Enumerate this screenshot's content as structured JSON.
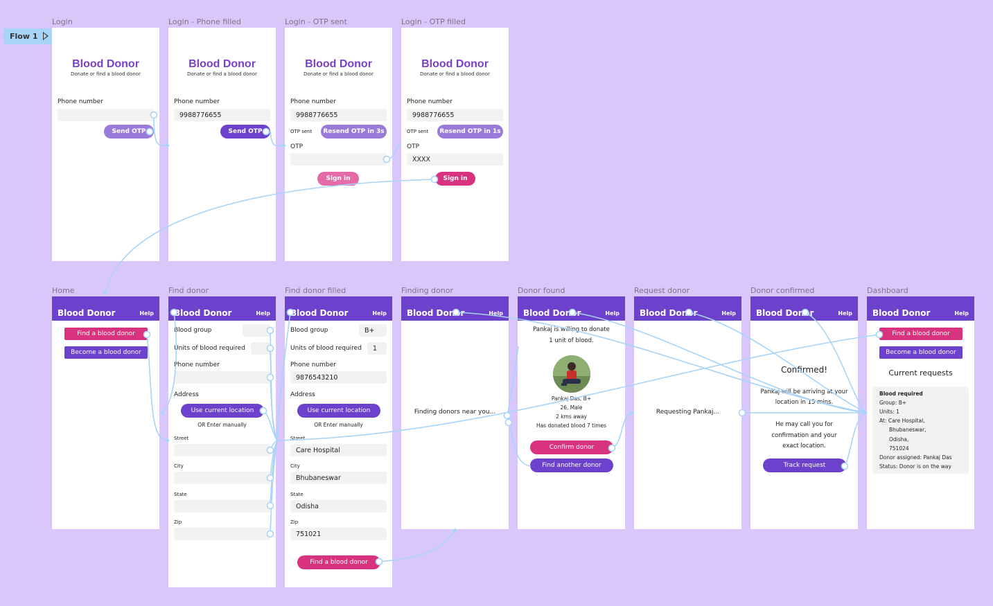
{
  "flow": {
    "label": "Flow 1",
    "play_icon": "play-icon"
  },
  "brand": {
    "name": "Blood Donor",
    "tagline": "Donate or find a blood donor",
    "primary": "#6c41cc",
    "accent": "#d9337f",
    "light_accent": "#e56aa8",
    "wire": "#a8d4f7",
    "canvas": "#d9c7fa"
  },
  "screens": {
    "login": {
      "label": "Login",
      "phone_label": "Phone number",
      "phone_value": "",
      "send_label": "Send OTP"
    },
    "login_phone": {
      "label": "Login - Phone filled",
      "phone_label": "Phone number",
      "phone_value": "9988776655",
      "send_label": "Send OTP"
    },
    "login_otp_sent": {
      "label": "Login - OTP sent",
      "phone_label": "Phone number",
      "phone_value": "9988776655",
      "otp_sent_label": "OTP sent",
      "resend_label": "Resend OTP in 3s",
      "otp_label": "OTP",
      "otp_value": "",
      "signin_label": "Sign in"
    },
    "login_otp_filled": {
      "label": "Login - OTP filled",
      "phone_label": "Phone number",
      "phone_value": "9988776655",
      "otp_sent_label": "OTP sent",
      "resend_label": "Resend OTP in 1s",
      "otp_label": "OTP",
      "otp_value": "XXXX",
      "signin_label": "Sign in"
    },
    "home": {
      "label": "Home",
      "header_title": "Blood Donor",
      "help": "Help",
      "find_label": "Find a blood donor",
      "become_label": "Become a blood donor"
    },
    "find_donor": {
      "label": "Find donor",
      "header_title": "Blood Donor",
      "help": "Help",
      "blood_group_label": "Blood group",
      "blood_group_value": "",
      "units_label": "Units of blood required",
      "units_value": "",
      "phone_label": "Phone number",
      "phone_value": "",
      "address_label": "Address",
      "use_location_label": "Use current location",
      "or_manual": "OR Enter manually",
      "street_label": "Street",
      "street_value": "",
      "city_label": "City",
      "city_value": "",
      "state_label": "State",
      "state_value": "",
      "zip_label": "Zip",
      "zip_value": ""
    },
    "find_donor_filled": {
      "label": "Find donor filled",
      "header_title": "Blood Donor",
      "help": "Help",
      "blood_group_label": "Blood group",
      "blood_group_value": "B+",
      "units_label": "Units of blood required",
      "units_value": "1",
      "phone_label": "Phone number",
      "phone_value": "9876543210",
      "address_label": "Address",
      "use_location_label": "Use current location",
      "or_manual": "OR Enter manually",
      "street_label": "Street",
      "street_value": "Care Hospital",
      "city_label": "City",
      "city_value": "Bhubaneswar",
      "state_label": "State",
      "state_value": "Odisha",
      "zip_label": "Zip",
      "zip_value": "751021",
      "find_label": "Find a blood donor"
    },
    "finding_donor": {
      "label": "Finding donor",
      "header_title": "Blood Donor",
      "help": "Help",
      "message": "Finding donors near you..."
    },
    "donor_found": {
      "label": "Donor found",
      "header_title": "Blood Donor",
      "help": "Help",
      "message_line1": "Pankaj is willing to donate",
      "message_line2": "1 unit of blood.",
      "donor_name": "Pankaj Das, B+",
      "donor_age": "26, Male",
      "donor_distance": "2 kms away",
      "donor_history": "Has donated blood 7 times",
      "confirm_label": "Confirm donor",
      "another_label": "Find another donor"
    },
    "request_donor": {
      "label": "Request donor",
      "header_title": "Blood Donor",
      "help": "Help",
      "message": "Requesting Pankaj..."
    },
    "donor_confirmed": {
      "label": "Donor confirmed",
      "header_title": "Blood Donor",
      "help": "Help",
      "heading": "Confirmed!",
      "line1": "Pankaj will be arriving at your",
      "line2": "location in 15 mins.",
      "line3": "He may call you for",
      "line4": "confirmation and your",
      "line5": "exact location.",
      "track_label": "Track request"
    },
    "dashboard": {
      "label": "Dashboard",
      "header_title": "Blood Donor",
      "help": "Help",
      "find_label": "Find a blood donor",
      "become_label": "Become a blood donor",
      "requests_heading": "Current requests",
      "card_title": "Blood required",
      "group": "Group: B+",
      "units": "Units: 1",
      "at_line1": "At: Care Hospital,",
      "at_line2": "Bhubaneswar,",
      "at_line3": "Odisha,",
      "at_line4": "751024",
      "assigned": "Donor assigned: Pankaj Das",
      "status": "Status: Donor is on the way"
    }
  }
}
